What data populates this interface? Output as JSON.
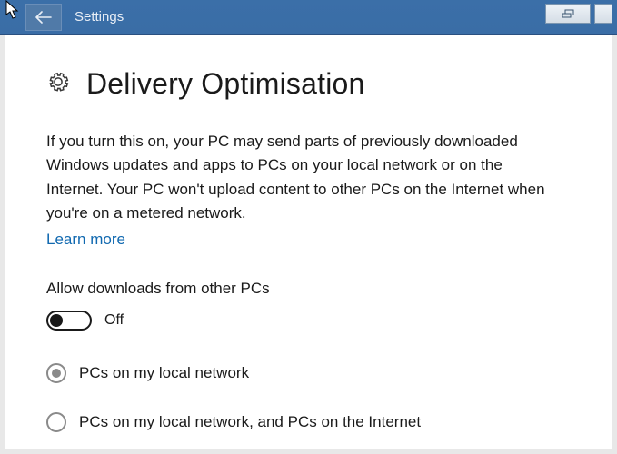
{
  "titlebar": {
    "title": "Settings"
  },
  "page": {
    "heading": "Delivery Optimisation",
    "description": "If you turn this on, your PC may send parts of previously downloaded Windows updates and apps to PCs on your local network or on the Internet. Your PC won't upload content to other PCs on the Internet when you're on a metered network.",
    "learn_more": "Learn more",
    "allow_label": "Allow downloads from other PCs",
    "toggle": {
      "state": "Off"
    },
    "options": [
      {
        "label": "PCs on my local network",
        "selected": true
      },
      {
        "label": "PCs on my local network, and PCs on the Internet",
        "selected": false
      }
    ]
  }
}
